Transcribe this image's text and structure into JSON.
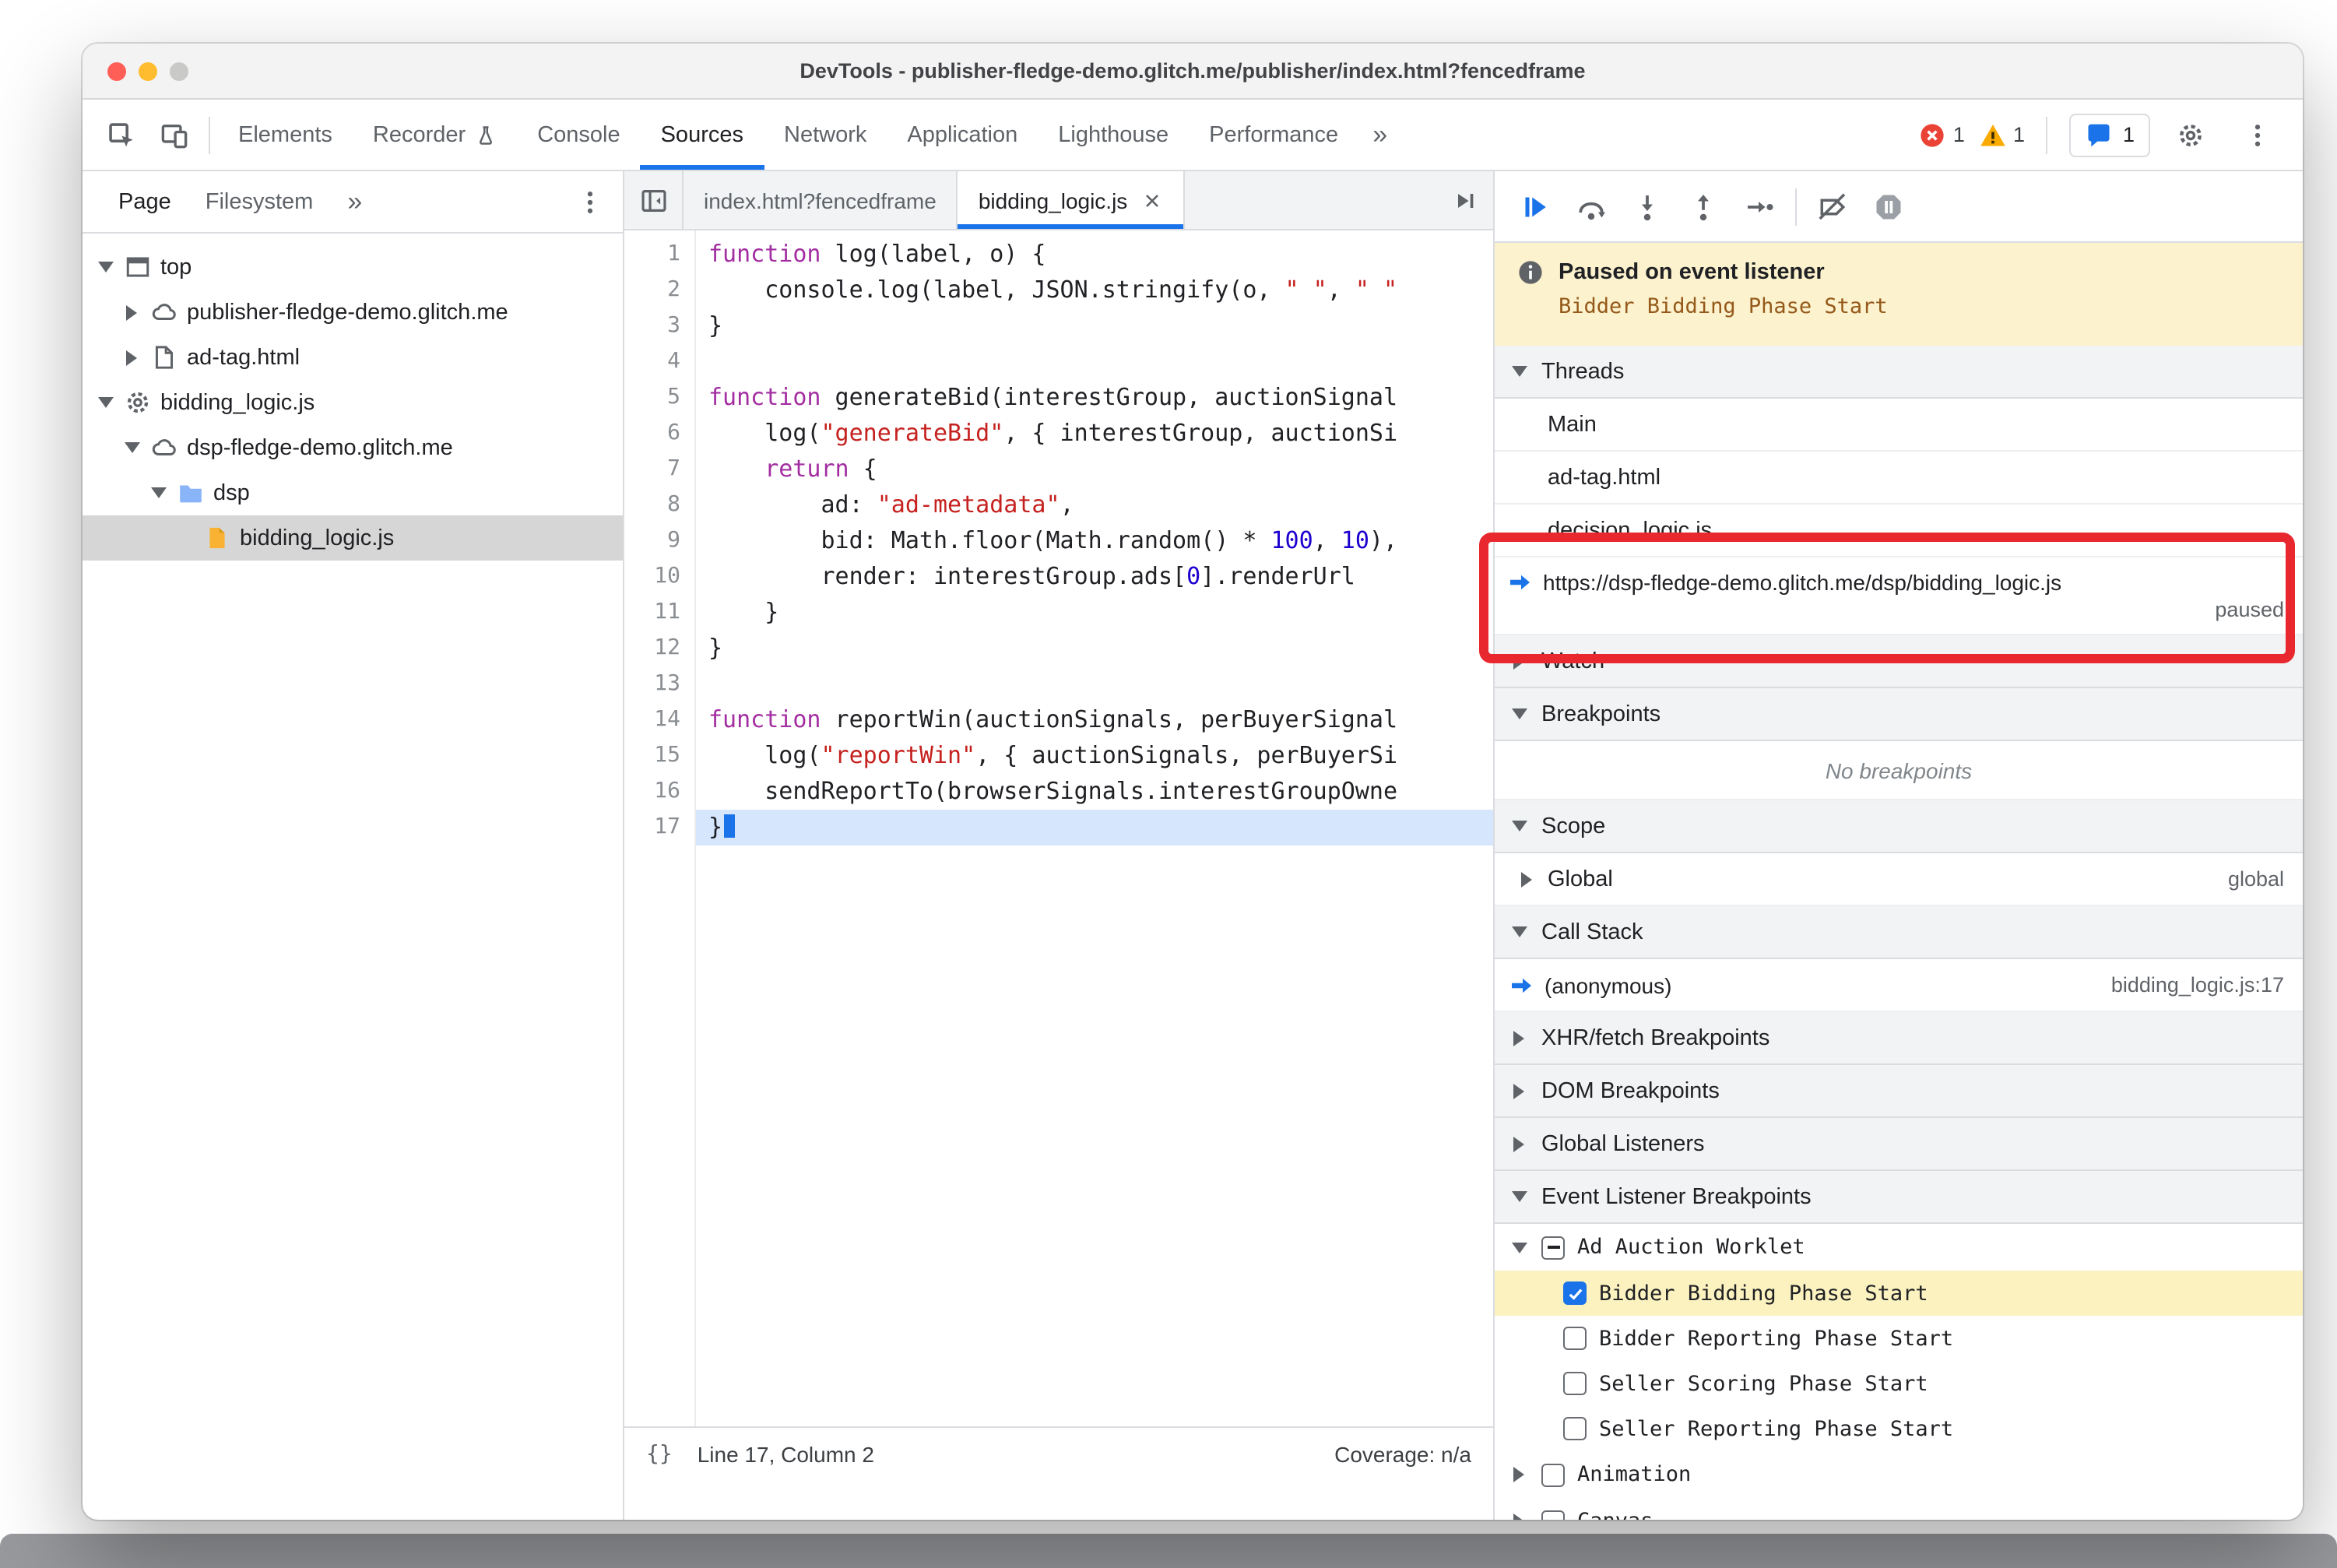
{
  "colors": {
    "accent": "#1a73e8",
    "annotation_red": "#e8272e",
    "paused_banner_bg": "#fcf2cd",
    "breakpoint_highlight": "#fbf2c0",
    "paused_line_bg": "#d6e6fd"
  },
  "window": {
    "title": "DevTools - publisher-fledge-demo.glitch.me/publisher/index.html?fencedframe",
    "traffic_lights": [
      {
        "name": "close-button",
        "color": "#ff5f57"
      },
      {
        "name": "minimize-button",
        "color": "#febc2e"
      },
      {
        "name": "zoom-button",
        "color": "#c9c9c7"
      }
    ]
  },
  "ui": {
    "chevron_double": "»"
  },
  "toolbar": {
    "left_icons": [
      "inspect-icon",
      "device-toolbar-icon"
    ],
    "tabs": [
      {
        "label": "Elements"
      },
      {
        "label": "Recorder",
        "icon": "beaker-icon"
      },
      {
        "label": "Console"
      },
      {
        "label": "Sources"
      },
      {
        "label": "Network"
      },
      {
        "label": "Application"
      },
      {
        "label": "Lighthouse"
      },
      {
        "label": "Performance"
      }
    ],
    "active_tab": "Sources",
    "badges": {
      "errors": "1",
      "warnings": "1",
      "issues": "1"
    }
  },
  "sidebar": {
    "tabs": [
      "Page",
      "Filesystem"
    ],
    "active_tab": "Page",
    "tree": [
      {
        "label": "top",
        "icon": "frame-icon",
        "depth": 0,
        "expand": "open"
      },
      {
        "label": "publisher-fledge-demo.glitch.me",
        "icon": "cloud-icon",
        "depth": 1,
        "expand": "closed"
      },
      {
        "label": "ad-tag.html",
        "icon": "document-icon",
        "depth": 1,
        "expand": "closed"
      },
      {
        "label": "bidding_logic.js",
        "icon": "worklet-gear-icon",
        "depth": 0,
        "expand": "open"
      },
      {
        "label": "dsp-fledge-demo.glitch.me",
        "icon": "cloud-icon",
        "depth": 1,
        "expand": "open"
      },
      {
        "label": "dsp",
        "icon": "folder-icon",
        "depth": 2,
        "expand": "open"
      },
      {
        "label": "bidding_logic.js",
        "icon": "js-file-icon",
        "depth": 3,
        "expand": "none",
        "selected": true
      }
    ]
  },
  "editor": {
    "tabs": [
      {
        "label": "index.html?fencedframe",
        "active": false,
        "closable": false
      },
      {
        "label": "bidding_logic.js",
        "active": true,
        "closable": true
      }
    ],
    "code": {
      "paused_line": 17,
      "lines": [
        {
          "n": 1,
          "tokens": [
            [
              "kw",
              "function"
            ],
            [
              "pln",
              " log(label, o) {"
            ]
          ]
        },
        {
          "n": 2,
          "tokens": [
            [
              "pln",
              "    console.log(label, JSON.stringify(o, "
            ],
            [
              "str",
              "\" \""
            ],
            [
              "pln",
              ", "
            ],
            [
              "str",
              "\" \""
            ]
          ]
        },
        {
          "n": 3,
          "tokens": [
            [
              "pln",
              "}"
            ]
          ]
        },
        {
          "n": 4,
          "tokens": []
        },
        {
          "n": 5,
          "tokens": [
            [
              "kw",
              "function"
            ],
            [
              "pln",
              " generateBid(interestGroup, auctionSignal"
            ]
          ]
        },
        {
          "n": 6,
          "tokens": [
            [
              "pln",
              "    log("
            ],
            [
              "str",
              "\"generateBid\""
            ],
            [
              "pln",
              ", { interestGroup, auctionSi"
            ]
          ]
        },
        {
          "n": 7,
          "tokens": [
            [
              "pln",
              "    "
            ],
            [
              "kw",
              "return"
            ],
            [
              "pln",
              " {"
            ]
          ]
        },
        {
          "n": 8,
          "tokens": [
            [
              "pln",
              "        ad: "
            ],
            [
              "str",
              "\"ad-metadata\""
            ],
            [
              "pln",
              ","
            ]
          ]
        },
        {
          "n": 9,
          "tokens": [
            [
              "pln",
              "        bid: Math.floor(Math.random() * "
            ],
            [
              "num",
              "100"
            ],
            [
              "pln",
              ", "
            ],
            [
              "num",
              "10"
            ],
            [
              "pln",
              "),"
            ]
          ]
        },
        {
          "n": 10,
          "tokens": [
            [
              "pln",
              "        render: interestGroup.ads["
            ],
            [
              "num",
              "0"
            ],
            [
              "pln",
              "].renderUrl"
            ]
          ]
        },
        {
          "n": 11,
          "tokens": [
            [
              "pln",
              "    }"
            ]
          ]
        },
        {
          "n": 12,
          "tokens": [
            [
              "pln",
              "}"
            ]
          ]
        },
        {
          "n": 13,
          "tokens": []
        },
        {
          "n": 14,
          "tokens": [
            [
              "kw",
              "function"
            ],
            [
              "pln",
              " reportWin(auctionSignals, perBuyerSignal"
            ]
          ]
        },
        {
          "n": 15,
          "tokens": [
            [
              "pln",
              "    log("
            ],
            [
              "str",
              "\"reportWin\""
            ],
            [
              "pln",
              ", { auctionSignals, perBuyerSi"
            ]
          ]
        },
        {
          "n": 16,
          "tokens": [
            [
              "pln",
              "    sendReportTo(browserSignals.interestGroupOwne"
            ]
          ]
        },
        {
          "n": 17,
          "tokens": [
            [
              "pln",
              "}"
            ]
          ]
        }
      ]
    },
    "statusbar": {
      "brace": "{}",
      "left": "Line 17, Column 2",
      "right": "Coverage: n/a"
    }
  },
  "debugger": {
    "toolbar_icons": [
      "resume-icon",
      "step-over-icon",
      "step-into-icon",
      "step-out-icon",
      "step-icon",
      "divider",
      "deactivate-breakpoints-icon",
      "pause-on-exceptions-icon"
    ],
    "paused_banner": {
      "title": "Paused on event listener",
      "subtitle": "Bidder Bidding Phase Start"
    },
    "threads": {
      "title": "Threads",
      "items": [
        {
          "label": "Main"
        },
        {
          "label": "ad-tag.html"
        },
        {
          "label": "decision_logic.js"
        },
        {
          "label": "https://dsp-fledge-demo.glitch.me/dsp/bidding_logic.js",
          "status": "paused",
          "active": true
        }
      ]
    },
    "watch": {
      "title": "Watch"
    },
    "breakpoints": {
      "title": "Breakpoints",
      "empty": "No breakpoints"
    },
    "scope": {
      "title": "Scope",
      "rows": [
        {
          "label": "Global",
          "value": "global"
        }
      ]
    },
    "call_stack": {
      "title": "Call Stack",
      "frames": [
        {
          "label": "(anonymous)",
          "location": "bidding_logic.js:17",
          "active": true
        }
      ]
    },
    "xhr_breakpoints": {
      "title": "XHR/fetch Breakpoints"
    },
    "dom_breakpoints": {
      "title": "DOM Breakpoints"
    },
    "global_listeners": {
      "title": "Global Listeners"
    },
    "event_listener_breakpoints": {
      "title": "Event Listener Breakpoints",
      "groups": [
        {
          "label": "Ad Auction Worklet",
          "state": "indeterminate",
          "expanded": true,
          "children": [
            {
              "label": "Bidder Bidding Phase Start",
              "checked": true,
              "highlighted": true
            },
            {
              "label": "Bidder Reporting Phase Start",
              "checked": false
            },
            {
              "label": "Seller Scoring Phase Start",
              "checked": false
            },
            {
              "label": "Seller Reporting Phase Start",
              "checked": false
            }
          ]
        },
        {
          "label": "Animation",
          "state": "unchecked",
          "expanded": false,
          "children": []
        },
        {
          "label": "Canvas",
          "state": "unchecked",
          "expanded": false,
          "children": []
        }
      ]
    }
  }
}
